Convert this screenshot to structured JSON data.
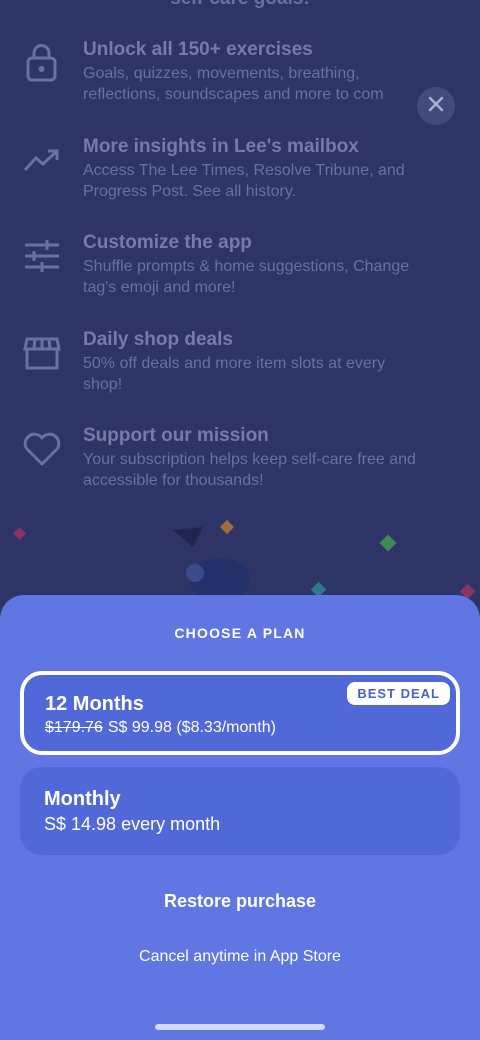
{
  "header": {
    "partial_title": "self-care goals!"
  },
  "features": [
    {
      "icon": "lock-icon",
      "title": "Unlock all 150+ exercises",
      "desc1": "Goals, quizzes, movements, breathing,",
      "desc2": "reflections, soundscapes and more to com"
    },
    {
      "icon": "trending-up-icon",
      "title": "More insights in Lee's mailbox",
      "desc1": "Access The Lee Times, Resolve Tribune, and",
      "desc2": "Progress Post. See all history."
    },
    {
      "icon": "sliders-icon",
      "title": "Customize the app",
      "desc1": "Shuffle prompts & home suggestions, Change",
      "desc2": "tag's emoji and more!"
    },
    {
      "icon": "storefront-icon",
      "title": "Daily shop deals",
      "desc1": "50% off deals and more item slots at every",
      "desc2": "shop!"
    },
    {
      "icon": "heart-icon",
      "title": "Support our mission",
      "desc1": "Your subscription helps keep self-care free and",
      "desc2": "accessible for thousands!"
    }
  ],
  "close_icon": "close-icon",
  "sheet": {
    "heading": "CHOOSE A PLAN",
    "plans": [
      {
        "name": "12 Months",
        "original_price": "$179.76",
        "price": "S$ 99.98 ($8.33/month)",
        "badge": "BEST DEAL",
        "selected": true
      },
      {
        "name": "Monthly",
        "price": "S$ 14.98 every month",
        "selected": false
      }
    ],
    "restore": "Restore purchase",
    "cancel_note": "Cancel anytime in App Store"
  },
  "colors": {
    "background": "#2e3566",
    "sheet": "#5f76e3",
    "plan": "#5169d8",
    "text_dim": "#767ba8"
  }
}
